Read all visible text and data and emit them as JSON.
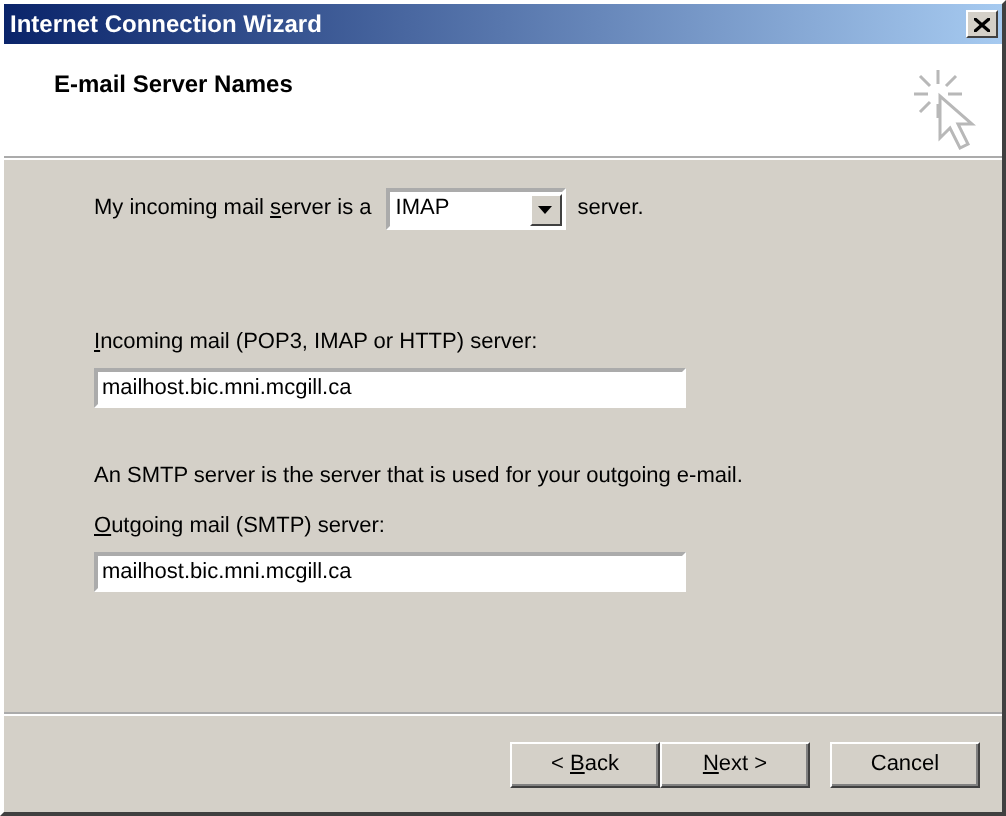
{
  "window": {
    "title": "Internet Connection Wizard"
  },
  "header": {
    "title": "E-mail Server Names"
  },
  "server_type": {
    "label": {
      "pre": "My incoming mail ",
      "key": "s",
      "post": "erver is a"
    },
    "value": "IMAP",
    "suffix": "server."
  },
  "incoming": {
    "label": {
      "key": "I",
      "post": "ncoming mail (POP3, IMAP or HTTP) server:"
    },
    "value": "mailhost.bic.mni.mcgill.ca"
  },
  "smtp_note": "An SMTP server is the server that is used for your outgoing e-mail.",
  "outgoing": {
    "label": {
      "key": "O",
      "post": "utgoing mail (SMTP) server:"
    },
    "value": "mailhost.bic.mni.mcgill.ca"
  },
  "buttons": [
    {
      "pre": "< ",
      "key": "B",
      "post": "ack"
    },
    {
      "key": "N",
      "post": "ext >"
    },
    {
      "label": "Cancel"
    }
  ]
}
